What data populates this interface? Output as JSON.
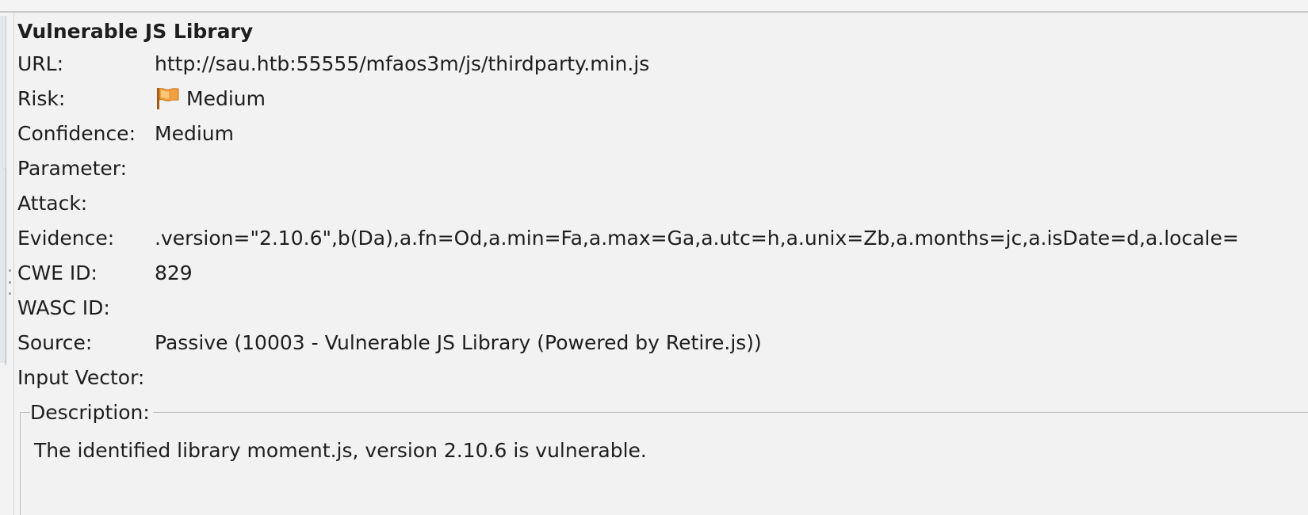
{
  "alert": {
    "title": "Vulnerable JS Library",
    "fields": [
      {
        "label": "URL:",
        "value": "http://sau.htb:55555/mfaos3m/js/thirdparty.min.js"
      },
      {
        "label": "Risk:",
        "value": "Medium",
        "icon": "orange-flag-icon"
      },
      {
        "label": "Confidence:",
        "value": "Medium"
      },
      {
        "label": "Parameter:",
        "value": ""
      },
      {
        "label": "Attack:",
        "value": ""
      },
      {
        "label": "Evidence:",
        "value": ".version=\"2.10.6\",b(Da),a.fn=Od,a.min=Fa,a.max=Ga,a.utc=h,a.unix=Zb,a.months=jc,a.isDate=d,a.locale="
      },
      {
        "label": "CWE ID:",
        "value": "829"
      },
      {
        "label": "WASC ID:",
        "value": ""
      },
      {
        "label": "Source:",
        "value": "Passive (10003 - Vulnerable JS Library (Powered by Retire.js))"
      },
      {
        "label": "Input Vector:",
        "value": ""
      }
    ],
    "description": {
      "legend": "Description:",
      "text": "The identified library moment.js, version 2.10.6 is vulnerable."
    }
  },
  "colors": {
    "risk_flag": "#f0a03c",
    "background": "#f2f2f2",
    "text": "#1e1e1e"
  }
}
